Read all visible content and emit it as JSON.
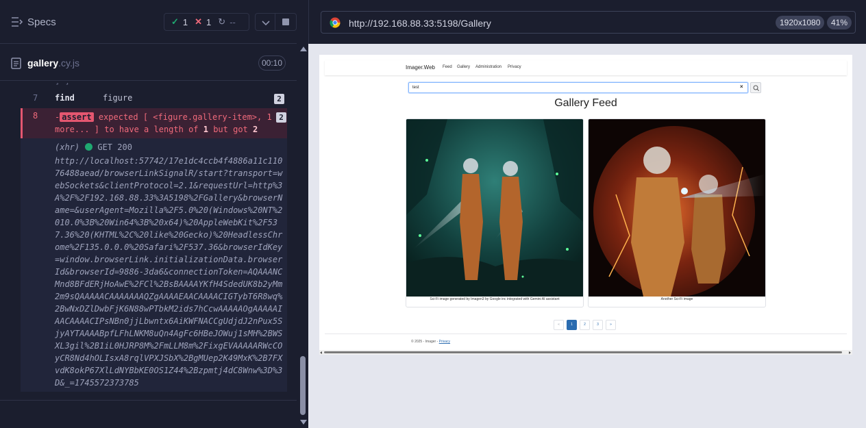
{
  "runner": {
    "specs_label": "Specs",
    "stats": {
      "passed": "1",
      "failed": "1",
      "pending": "--"
    },
    "file": {
      "name": "gallery",
      "ext": ".cy.js",
      "duration": "00:10"
    },
    "commands": [
      {
        "num": "7",
        "name": "find",
        "message": "figure",
        "badge": "2"
      },
      {
        "num": "8",
        "prefix": "-",
        "name": "assert",
        "line1": "expected [ <figure.gallery-item>, 1",
        "line2_a": "more... ] to have a length of ",
        "line2_b": "1",
        "line2_c": " but got ",
        "line2_d": "2",
        "badge": "2"
      }
    ],
    "xhr": {
      "label": "(xhr)",
      "status": "GET 200",
      "url": "http://localhost:57742/17e1dc4ccb4f4886a11c11076488aead/browserLinkSignalR/start?transport=webSockets&clientProtocol=2.1&requestUrl=http%3A%2F%2F192.168.88.33%3A5198%2FGallery&browserName=&userAgent=Mozilla%2F5.0%20(Windows%20NT%2010.0%3B%20Win64%3B%20x64)%20AppleWebKit%2F537.36%20(KHTML%2C%20like%20Gecko)%20HeadlessChrome%2F135.0.0.0%20Safari%2F537.36&browserIdKey=window.browserLink.initializationData.browserId&browserId=9886-3da6&connectionToken=AQAAANCMnd8BFdERjHoAwE%2FCl%2BsBAAAAYKfH4SdedUK8b2yMm2m9sQAAAAACAAAAAAAQZgAAAAEAACAAAACIGTybT6R8wq%2BwNxDZlDwbFjK6N88wPTbkM2ids7hCcwAAAAAOgAAAAAIAACAAAACIPsNBn0jjLbwntx6AiKWFNACCgUdjdJ2nPux5SjyAYTAAAABpfLFhLNKM8uQn4AgFc6HBeJOWuj1sMH%2BWSXL3gil%2B1iL0HJRP8M%2FmLLM8m%2FixgEVAAAAARWcCOyCR8Nd4hOLIsxA8rqlVPXJSbX%2BgMUep2K49MxK%2B7FXvdK8okP67XlLdNYBbKE0OS1Z44%2Bzpmtj4dC8Wnw%3D%3D&_=1745572373785"
    }
  },
  "preview": {
    "url": "http://192.168.88.33:5198/Gallery",
    "viewport": "1920x1080",
    "zoom": "41%",
    "site": {
      "brand": "Imager.Web",
      "nav": [
        "Feed",
        "Gallery",
        "Administration",
        "Privacy"
      ],
      "search_value": "test",
      "title": "Gallery Feed",
      "cards": [
        {
          "caption": "Sci-Fi image generated by Imagen3 by Google inc integrated with Gemini AI assistant"
        },
        {
          "caption": "Another Sci-Fi image"
        }
      ],
      "pager": [
        "«",
        "1",
        "2",
        "3",
        "»"
      ],
      "footer_text": "© 2025 - Imager - ",
      "footer_link": "Privacy"
    }
  },
  "colors": {
    "pass": "#1fa971",
    "fail": "#f06a7b",
    "accent": "#2b6cb0"
  }
}
